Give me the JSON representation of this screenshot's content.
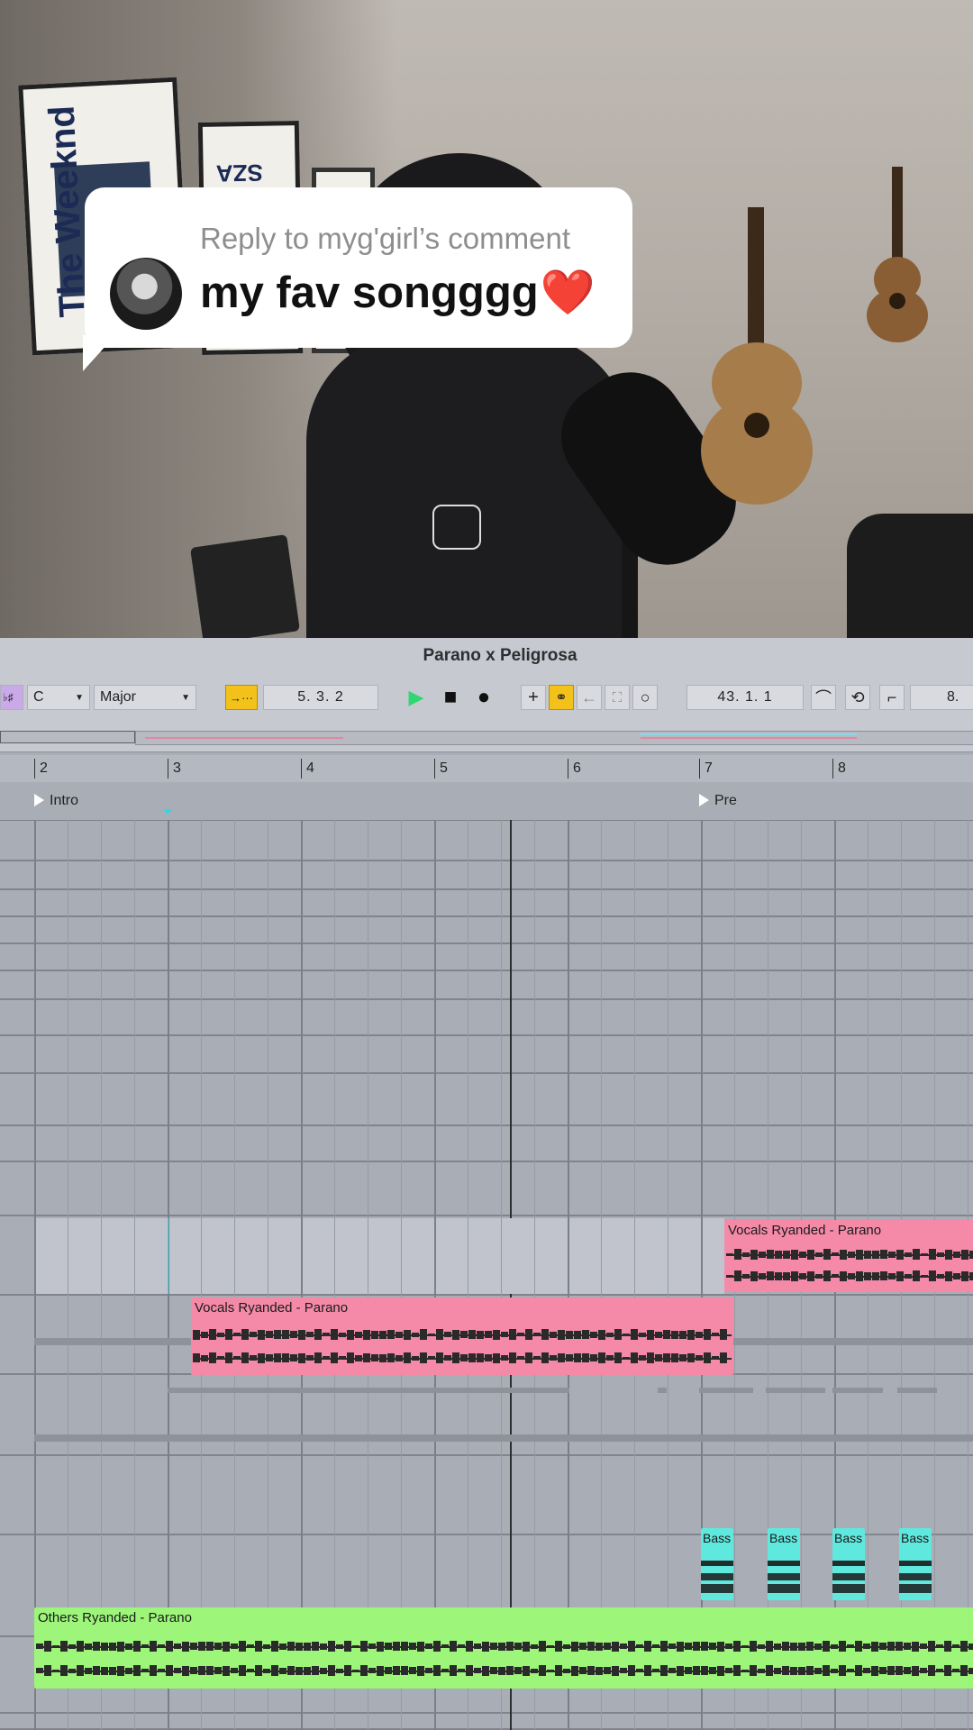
{
  "reply": {
    "label": "Reply to myg'girl’s comment",
    "text": "my fav songggg",
    "emoji": "❤️"
  },
  "posters": {
    "left_poster_text": "The Weeknd",
    "mid_poster_text": "SZA"
  },
  "daw": {
    "song_title": "Parano x Peligrosa",
    "controls": {
      "key_icon": "♭♯",
      "key": "C",
      "scale": "Major",
      "follow_icon": "→···",
      "position": "5.  3.  2",
      "play_icon": "▶",
      "stop_icon": "■",
      "record_icon": "●",
      "add_icon": "+",
      "link_icon": "⚭",
      "back_icon": "←",
      "capture_icon": "⛶",
      "loop_circle_icon": "○",
      "loop_start": "43.  1.  1",
      "punch_in_icon": "⌒",
      "loop_icon": "⟲",
      "punch_out_icon": "⌐",
      "loop_length": "8."
    },
    "ruler_bars": [
      "2",
      "3",
      "4",
      "5",
      "6",
      "7",
      "8"
    ],
    "locators": [
      {
        "name": "Intro"
      },
      {
        "name": "Pre"
      }
    ],
    "clips": [
      {
        "name": "Vocals Ryanded - Parano",
        "color": "#f48aa8"
      },
      {
        "name": "Vocals Ryanded - Parano",
        "color": "#f48aa8"
      },
      {
        "name": "Bass",
        "color": "#5fe8de"
      },
      {
        "name": "Bass",
        "color": "#5fe8de"
      },
      {
        "name": "Bass",
        "color": "#5fe8de"
      },
      {
        "name": "Bass",
        "color": "#5fe8de"
      },
      {
        "name": "Others Ryanded - Parano",
        "color": "#9df57a"
      }
    ]
  }
}
